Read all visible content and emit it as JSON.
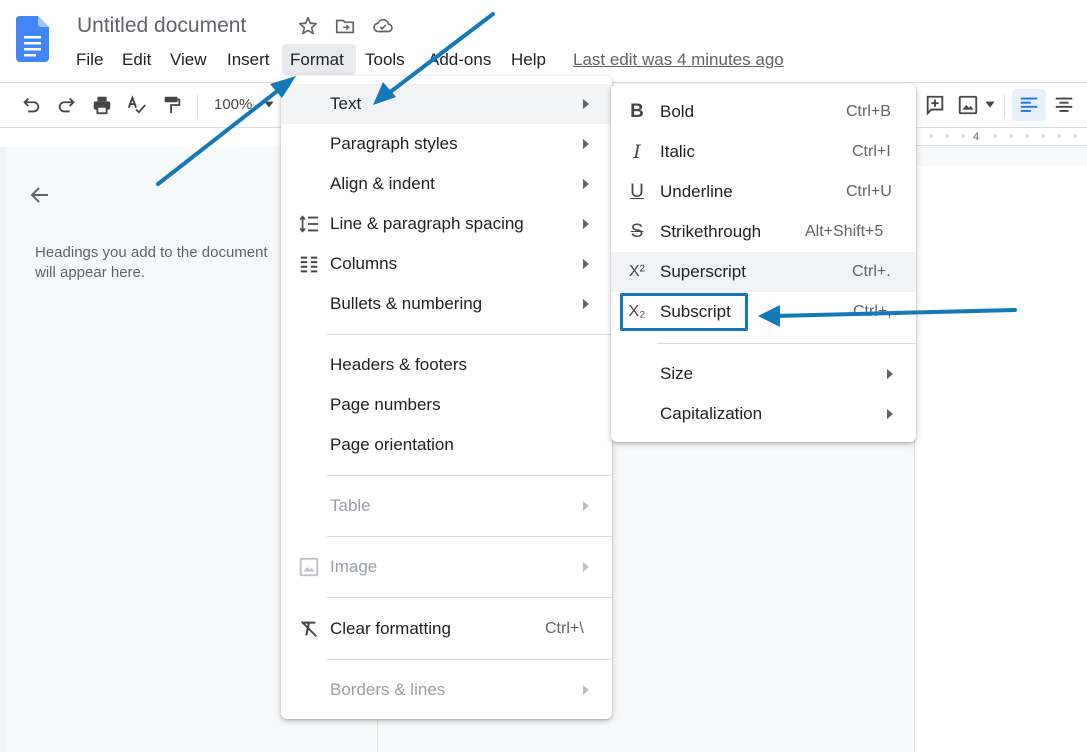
{
  "document": {
    "title": "Untitled document",
    "last_edit": "Last edit was 4 minutes ago"
  },
  "menubar": {
    "items": [
      {
        "label": "File"
      },
      {
        "label": "Edit"
      },
      {
        "label": "View"
      },
      {
        "label": "Insert"
      },
      {
        "label": "Format"
      },
      {
        "label": "Tools"
      },
      {
        "label": "Add-ons"
      },
      {
        "label": "Help"
      }
    ]
  },
  "toolbar": {
    "zoom": "100%",
    "ruler_mark": "4"
  },
  "sidebar": {
    "hint": "Headings you add to the document will appear here."
  },
  "format_menu": {
    "items": [
      {
        "label": "Text"
      },
      {
        "label": "Paragraph styles"
      },
      {
        "label": "Align & indent"
      },
      {
        "label": "Line & paragraph spacing"
      },
      {
        "label": "Columns"
      },
      {
        "label": "Bullets & numbering"
      },
      {
        "label": "Headers & footers"
      },
      {
        "label": "Page numbers"
      },
      {
        "label": "Page orientation"
      },
      {
        "label": "Table"
      },
      {
        "label": "Image"
      },
      {
        "label": "Clear formatting",
        "shortcut": "Ctrl+\\"
      },
      {
        "label": "Borders & lines"
      }
    ]
  },
  "text_menu": {
    "items": [
      {
        "label": "Bold",
        "shortcut": "Ctrl+B",
        "icon": "B"
      },
      {
        "label": "Italic",
        "shortcut": "Ctrl+I",
        "icon": "I"
      },
      {
        "label": "Underline",
        "shortcut": "Ctrl+U",
        "icon": "U"
      },
      {
        "label": "Strikethrough",
        "shortcut": "Alt+Shift+5",
        "icon": "S"
      },
      {
        "label": "Superscript",
        "shortcut": "Ctrl+.",
        "icon": "X²"
      },
      {
        "label": "Subscript",
        "shortcut": "Ctrl+,",
        "icon": "X₂"
      },
      {
        "label": "Size"
      },
      {
        "label": "Capitalization"
      }
    ]
  },
  "colors": {
    "annotation_arrow": "#1479b8",
    "docs_blue": "#4285f4"
  }
}
